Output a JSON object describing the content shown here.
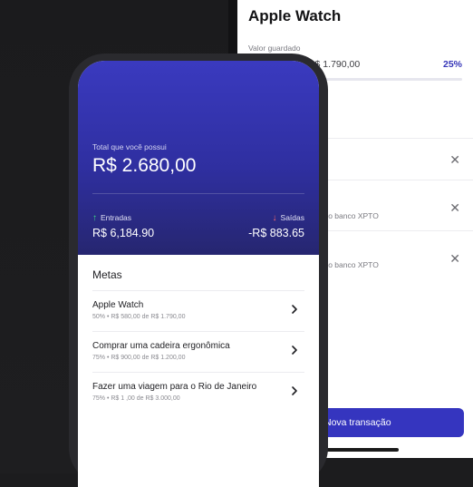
{
  "back_screen": {
    "title": "Apple Watch",
    "saved_label": "Valor guardado",
    "saved_value": "R$ 580,00 de R$ 1.790,00",
    "percent_label": "25%",
    "progress_fraction": 0.25,
    "transactions": [
      {
        "text": ""
      },
      {
        "text": "Rendimento de 110% no banco XPTO"
      },
      {
        "text": "Rendimento de 110% no banco XPTO"
      }
    ],
    "button_label": "Nova transação"
  },
  "front_screen": {
    "total_label": "Total que você possui",
    "total_value": "R$ 2.680,00",
    "income_label": "Entradas",
    "income_value": "R$ 6,184.90",
    "expense_label": "Saídas",
    "expense_value": "-R$ 883.65",
    "goals_title": "Metas",
    "goals": [
      {
        "name": "Apple Watch",
        "detail": "50% • R$ 580,00 de R$ 1.790,00"
      },
      {
        "name": "Comprar uma cadeira ergonômica",
        "detail": "75% • R$ 900,00 de R$ 1.200,00"
      },
      {
        "name": "Fazer uma viagem para o Rio de Janeiro",
        "detail": "75% • R$ 1 ,00 de R$ 3.000,00"
      }
    ]
  },
  "colors": {
    "accent": "#3535bf",
    "income_arrow": "#3ddc84",
    "expense_arrow": "#ff6b6b"
  },
  "icons": [
    "close-icon",
    "arrow-up-icon",
    "arrow-down-icon",
    "chevron-right-icon"
  ]
}
